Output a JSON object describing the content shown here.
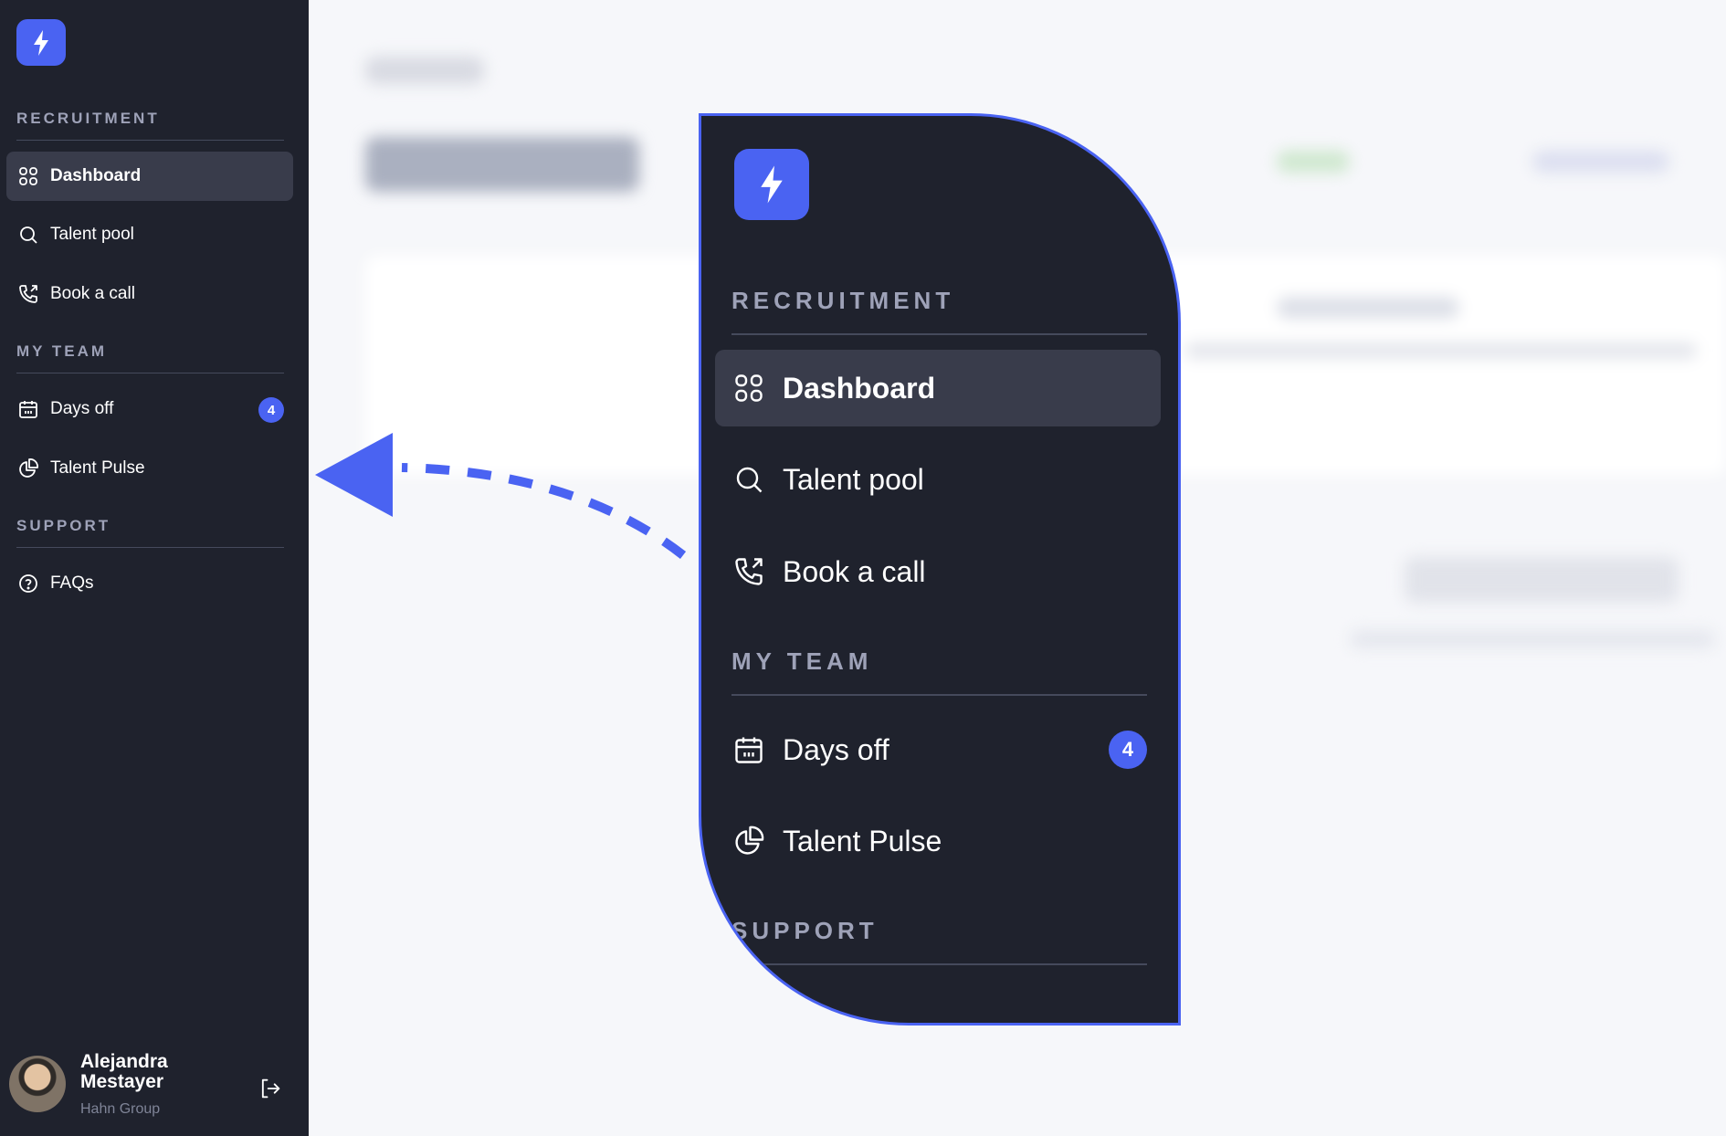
{
  "sidebar": {
    "sections": [
      {
        "title": "RECRUITMENT",
        "items": [
          {
            "label": "Dashboard",
            "icon": "grid-icon",
            "active": true
          },
          {
            "label": "Talent pool",
            "icon": "search-icon"
          },
          {
            "label": "Book a call",
            "icon": "phone-outgoing-icon"
          }
        ]
      },
      {
        "title": "MY TEAM",
        "items": [
          {
            "label": "Days off",
            "icon": "calendar-icon",
            "badge": "4"
          },
          {
            "label": "Talent Pulse",
            "icon": "pie-chart-icon"
          }
        ]
      },
      {
        "title": "SUPPORT",
        "items": [
          {
            "label": "FAQs",
            "icon": "help-circle-icon"
          }
        ]
      }
    ],
    "user": {
      "name": "Alejandra Mestayer",
      "organization": "Hahn Group"
    }
  },
  "colors": {
    "sidebar_bg": "#1f222d",
    "active_item_bg": "#393c4b",
    "accent": "#4a63f2",
    "section_title": "#9ea2b8"
  }
}
